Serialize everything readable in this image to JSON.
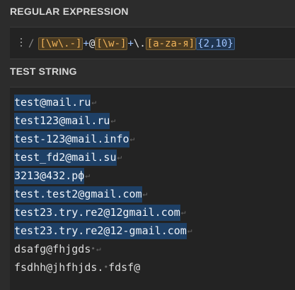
{
  "regex_section": {
    "title": "REGULAR EXPRESSION",
    "delimiter": "/",
    "tokens": [
      {
        "text": "[\\w\\.-]",
        "kind": "set"
      },
      {
        "text": "+",
        "kind": "quant"
      },
      {
        "text": "@",
        "kind": "lit"
      },
      {
        "text": "[\\w-]",
        "kind": "set"
      },
      {
        "text": "+",
        "kind": "quant"
      },
      {
        "text": "\\.",
        "kind": "esc"
      },
      {
        "text": "[a-zа-я]",
        "kind": "set"
      },
      {
        "text": "{2,10}",
        "kind": "quantbox"
      }
    ]
  },
  "test_section": {
    "title": "TEST STRING",
    "lines": [
      {
        "text": "test@mail.ru",
        "match": true,
        "trailing_space": false
      },
      {
        "text": "test123@mail.ru",
        "match": true,
        "trailing_space": false
      },
      {
        "text": "test-123@mail.info",
        "match": true,
        "trailing_space": false
      },
      {
        "text": "test_fd2@mail.su",
        "match": true,
        "trailing_space": false
      },
      {
        "text": "3213@432.рф",
        "match": true,
        "trailing_space": false
      },
      {
        "text": "test.test2@gmail.com",
        "match": true,
        "trailing_space": false
      },
      {
        "text": "test23.try.re2@12gmail.com",
        "match": true,
        "trailing_space": false
      },
      {
        "text": "test23.try.re2@12-gmail.com",
        "match": true,
        "trailing_space": false
      },
      {
        "text": "dsafg@fhjgds",
        "match": false,
        "trailing_space": true
      },
      {
        "text": "fsdhh@jhfhjds.",
        "match": false,
        "after_space": "fdsf@",
        "trailing_space": false
      }
    ]
  },
  "glyphs": {
    "newline": "↵",
    "space": "•"
  },
  "colors": {
    "background": "#2c2c2c",
    "editor_background": "#232323",
    "match_highlight": "#1e4066",
    "charset_highlight": "#4a3a20",
    "quantifier_color": "#9fc4ff"
  }
}
